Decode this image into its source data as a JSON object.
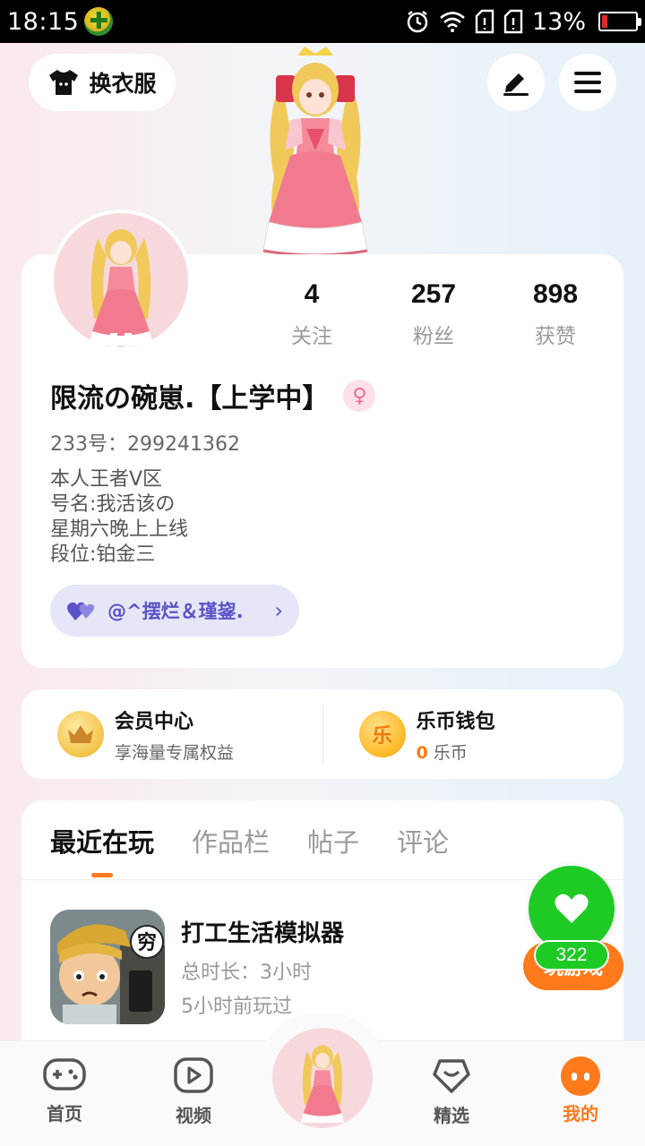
{
  "status_bar": {
    "time": "18:15",
    "battery_percent": "13%"
  },
  "header": {
    "dress_label": "换衣服"
  },
  "profile": {
    "stats": [
      {
        "value": "4",
        "label": "关注"
      },
      {
        "value": "257",
        "label": "粉丝"
      },
      {
        "value": "898",
        "label": "获赞"
      }
    ],
    "username": "限流の碗崽.【上学中】",
    "gender_symbol": "♀",
    "uid": "233号：299241362",
    "bio": [
      "本人王者V区",
      "号名:我活该の",
      "星期六晚上上线",
      "段位:铂金三"
    ],
    "cp_label": "@^摆烂＆瑾鋆."
  },
  "vip": {
    "member_title": "会员中心",
    "member_sub": "享海量专属权益",
    "wallet_title": "乐币钱包",
    "wallet_icon_text": "乐",
    "wallet_amount": "0",
    "wallet_unit": "乐币"
  },
  "tabs": [
    "最近在玩",
    "作品栏",
    "帖子",
    "评论"
  ],
  "recent_game": {
    "icon_badge": "穷",
    "title": "打工生活模拟器",
    "duration": "总时长：3小时",
    "last_played": "5小时前玩过",
    "play_label": "玩游戏"
  },
  "like_button": {
    "count": "322"
  },
  "bottom_nav": {
    "home": "首页",
    "video": "视频",
    "picks": "精选",
    "mine": "我的"
  },
  "colors": {
    "accent": "#ff7a1a",
    "like_green": "#1ecb24",
    "cp_purple": "#5a52c8"
  }
}
